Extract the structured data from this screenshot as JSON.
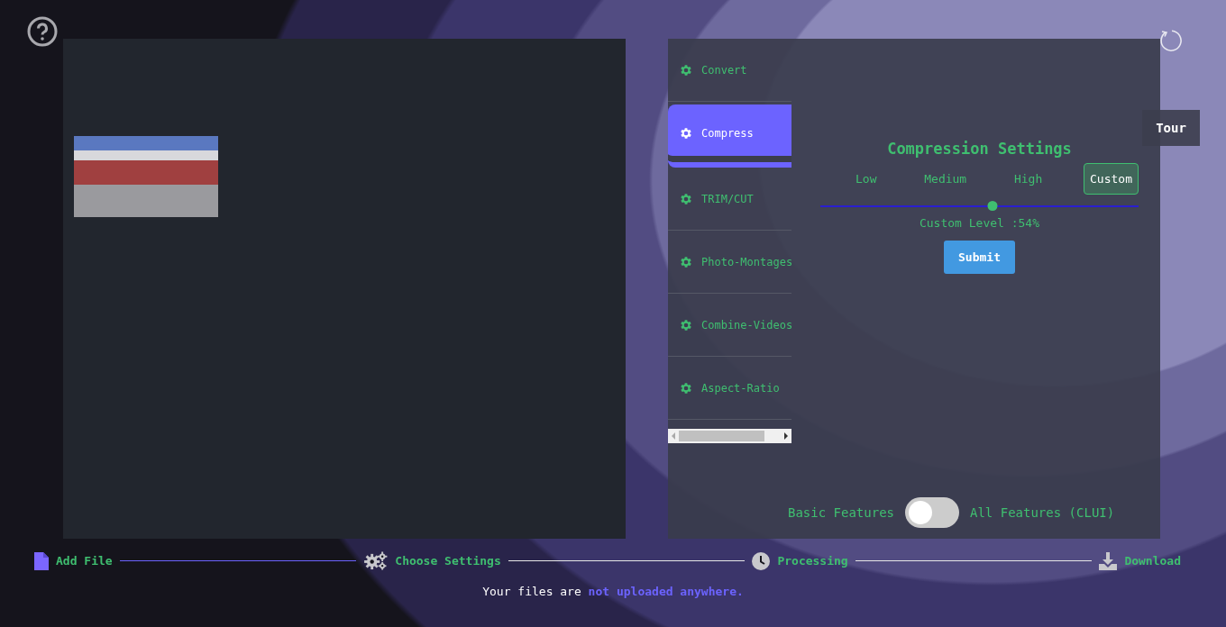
{
  "tour_button": {
    "label": "Tour"
  },
  "tools": [
    {
      "label": "Convert",
      "selected": false
    },
    {
      "label": "Compress",
      "selected": true
    },
    {
      "label": "TRIM/CUT",
      "selected": false
    },
    {
      "label": "Photo-Montages",
      "selected": false
    },
    {
      "label": "Combine-Videos",
      "selected": false
    },
    {
      "label": "Aspect-Ratio",
      "selected": false
    }
  ],
  "compression": {
    "title": "Compression Settings",
    "options": [
      {
        "label": "Low",
        "selected": false
      },
      {
        "label": "Medium",
        "selected": false
      },
      {
        "label": "High",
        "selected": false
      },
      {
        "label": "Custom",
        "selected": true
      }
    ],
    "level": 0.54,
    "reading": "Custom Level :54%",
    "submit": "Submit"
  },
  "mode_switch": {
    "left_label": "Basic Features",
    "right_label": "All Features (CLUI)",
    "on": false
  },
  "steps": [
    {
      "kind": "file",
      "label": "Add File"
    },
    {
      "kind": "gears",
      "label": "Choose Settings"
    },
    {
      "kind": "clock",
      "label": "Processing"
    },
    {
      "kind": "download",
      "label": "Download"
    }
  ],
  "connectors": [
    {
      "completed": true
    },
    {
      "completed": false
    },
    {
      "completed": false
    }
  ],
  "footer": "Your files are **not uploaded anywhere.**"
}
